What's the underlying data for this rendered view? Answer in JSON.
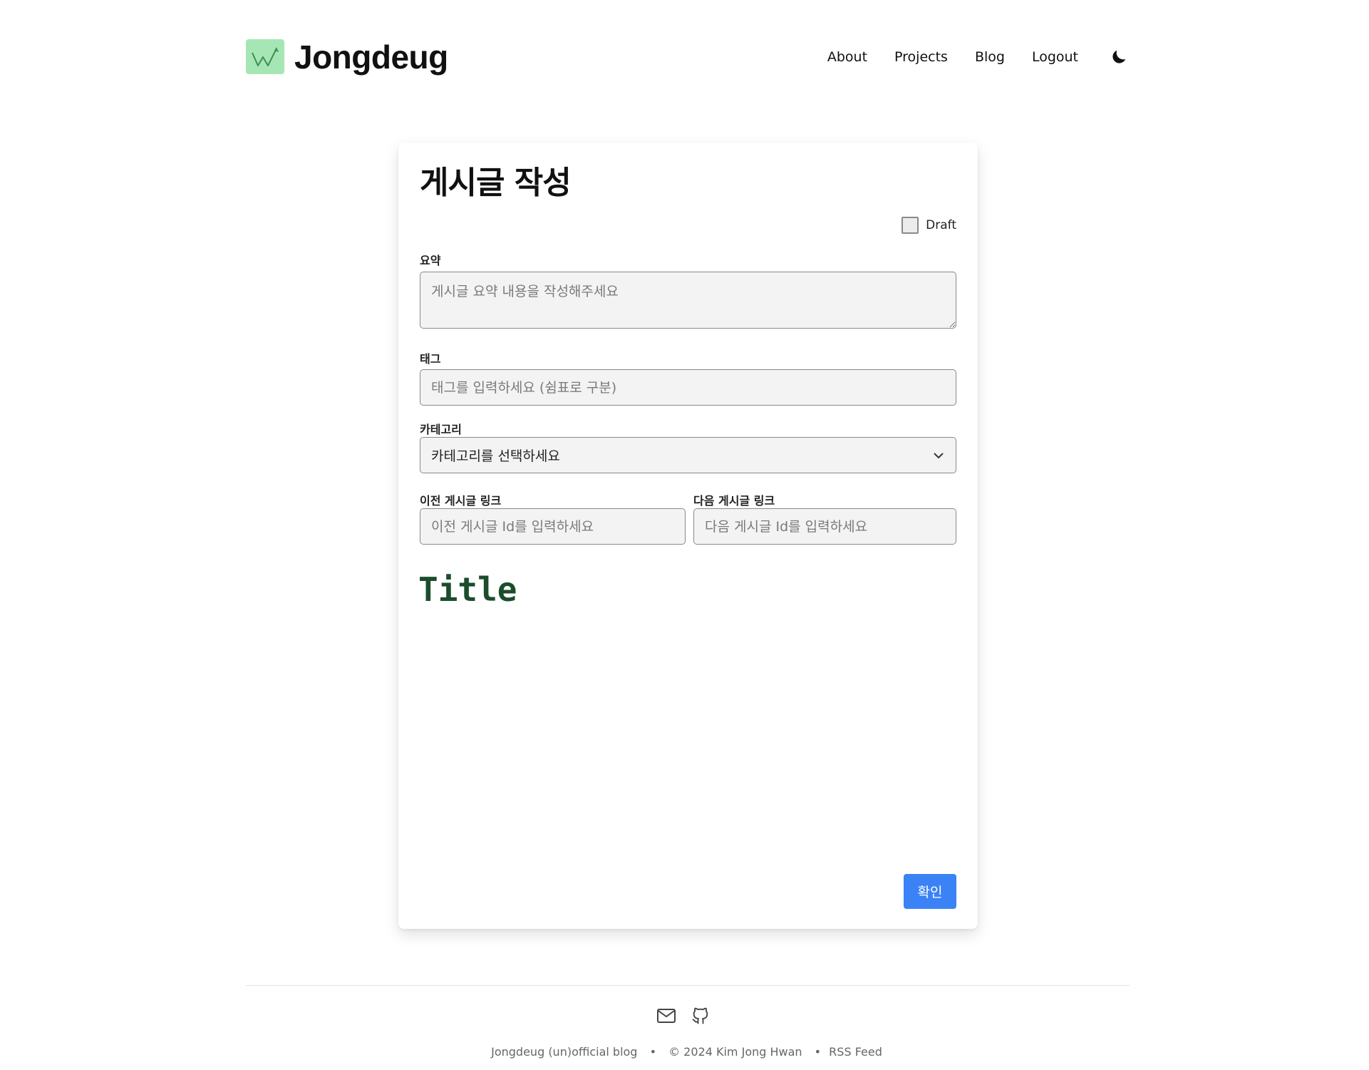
{
  "header": {
    "brand": "Jongdeug",
    "logo_icon": "chart-trend-icon",
    "nav": [
      "About",
      "Projects",
      "Blog",
      "Logout"
    ],
    "theme_icon": "moon-icon"
  },
  "form": {
    "title": "게시글 작성",
    "draft_label": "Draft",
    "draft_checked": false,
    "summary": {
      "label": "요약",
      "placeholder": "게시글 요약 내용을 작성해주세요",
      "value": ""
    },
    "tags": {
      "label": "태그",
      "placeholder": "태그를 입력하세요 (쉼표로 구분)",
      "value": ""
    },
    "category": {
      "label": "카테고리",
      "selected": "카테고리를 선택하세요"
    },
    "prev_link": {
      "label": "이전 게시글 링크",
      "placeholder": "이전 게시글 Id를 입력하세요",
      "value": ""
    },
    "next_link": {
      "label": "다음 게시글 링크",
      "placeholder": "다음 게시글 Id를 입력하세요",
      "value": ""
    },
    "editor_title_placeholder": "Title",
    "confirm_label": "확인"
  },
  "footer": {
    "icons": [
      "mail-icon",
      "github-icon"
    ],
    "blog_name": "Jongdeug (un)official blog",
    "separator": "•",
    "copyright": "© 2024 Kim Jong Hwan",
    "rss": "RSS Feed"
  },
  "colors": {
    "logo_bg": "#a6e6b4",
    "editor_title": "#1b4d2c",
    "primary_button": "#3b82f6"
  }
}
